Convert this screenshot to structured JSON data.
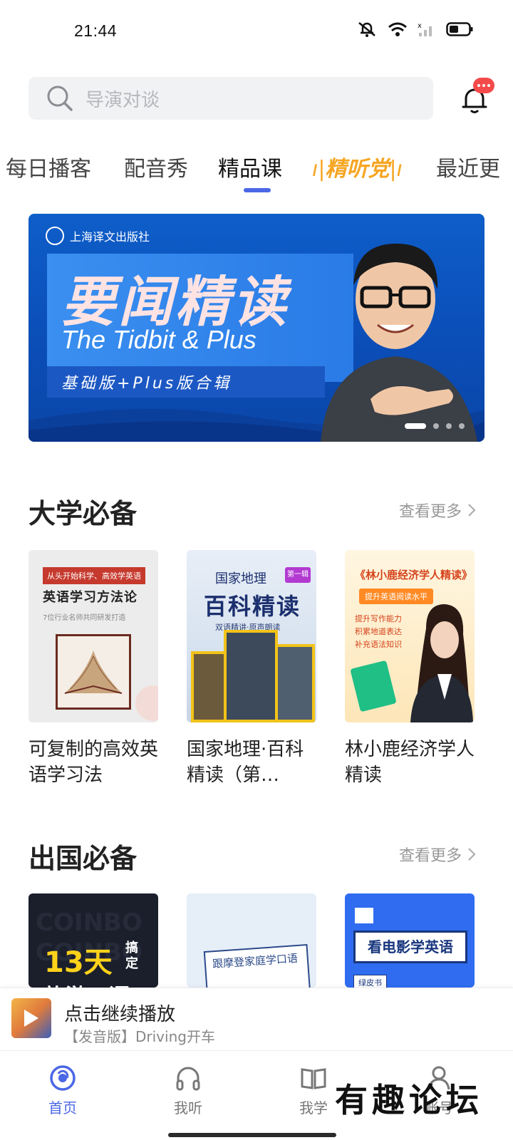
{
  "status_bar": {
    "time": "21:44",
    "icons": [
      "mute-bell-icon",
      "wifi-icon",
      "cellular-signal-icon",
      "battery-icon"
    ]
  },
  "search": {
    "placeholder": "导演对谈"
  },
  "tabs": [
    {
      "label": "每日播客"
    },
    {
      "label": "配音秀"
    },
    {
      "label": "精品课",
      "active": true
    },
    {
      "label": "精听党"
    },
    {
      "label": "最近更"
    }
  ],
  "banner": {
    "publisher": "上海译文出版社",
    "title_cn": "要闻精读",
    "title_en": "The Tidbit & Plus",
    "subtitle": "基础版+Plus版合辑",
    "slide_count": 4,
    "active_slide": 1
  },
  "sections": [
    {
      "title": "大学必备",
      "more_label": "查看更多",
      "cards": [
        {
          "title": "可复制的高效英语学习法",
          "cover": {
            "tagline": "从头开始科学、高效学英语",
            "headline": "英语学习方法论",
            "sub": "7位行业名师共同研发打造"
          }
        },
        {
          "title": "国家地理·百科精读（第…",
          "cover": {
            "top": "国家地理",
            "badge": "第一辑",
            "headline": "百科精读",
            "sub": "双语精讲·原声朗读"
          }
        },
        {
          "title": "林小鹿经济学人精读",
          "cover": {
            "headline": "《林小鹿经济学人精读》",
            "badge": "提升英语阅读水平",
            "points": [
              "提升写作能力",
              "积累地道表达",
              "补充语法知识"
            ]
          }
        }
      ]
    },
    {
      "title": "出国必备",
      "more_label": "查看更多",
      "cards": [
        {
          "cover": {
            "big": "13天",
            "side": "搞定",
            "low": "旅游口语"
          }
        },
        {
          "cover": {
            "headline": "跟摩登家庭学口语"
          }
        },
        {
          "cover": {
            "headline": "看电影学英语",
            "tag": "绿皮书"
          }
        }
      ]
    }
  ],
  "mini_player": {
    "title": "点击继续播放",
    "subtitle": "【发音版】Driving开车"
  },
  "bottom_nav": [
    {
      "label": "首页",
      "icon": "home-icon",
      "active": true
    },
    {
      "label": "我听",
      "icon": "headphones-icon"
    },
    {
      "label": "我学",
      "icon": "book-icon"
    },
    {
      "label": "账号",
      "icon": "user-icon"
    }
  ],
  "watermark": "有趣论坛",
  "colors": {
    "accent": "#4b67e6",
    "badge": "#f44a4a",
    "special_tab": "#f6a623"
  }
}
